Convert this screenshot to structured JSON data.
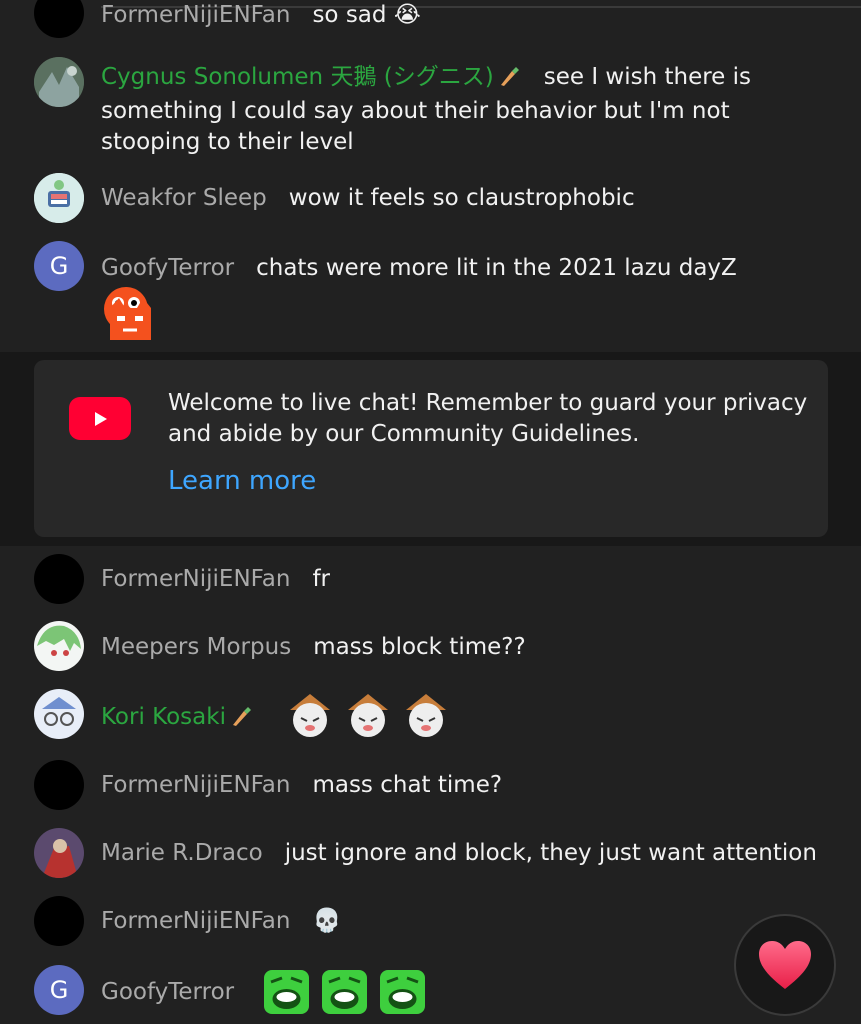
{
  "messages": [
    {
      "author": "FormerNijiENFan",
      "text": "so sad",
      "emoji": "😭"
    },
    {
      "author": "Cygnus Sonolumen 天鵝 (シグニス)",
      "text": "see I wish there is something I could say about their behavior but I'm not stooping to their level"
    },
    {
      "author": "Weakfor Sleep",
      "text": "wow it feels so claustrophobic"
    },
    {
      "author": "GoofyTerror",
      "text": "chats were more lit in the 2021 lazu dayZ",
      "avatar_letter": "G"
    },
    {
      "author": "FormerNijiENFan",
      "text": "fr"
    },
    {
      "author": "Meepers Morpus",
      "text": "mass block time??"
    },
    {
      "author": "Kori Kosaki",
      "text": ""
    },
    {
      "author": "FormerNijiENFan",
      "text": "mass chat time?"
    },
    {
      "author": "Marie R.Draco",
      "text": "just ignore and block, they just want attention"
    },
    {
      "author": "FormerNijiENFan",
      "text": "",
      "emoji": "💀"
    },
    {
      "author": "GoofyTerror",
      "text": "",
      "avatar_letter": "G"
    }
  ],
  "welcome": {
    "text": "Welcome to live chat! Remember to guard your privacy and abide by our Community Guidelines.",
    "link": "Learn more"
  },
  "colors": {
    "background": "#212121",
    "member_name": "#2ba640",
    "author_name": "#aaaaaa",
    "link": "#3ea6ff",
    "youtube_red": "#ff0033"
  },
  "icons": [
    "youtube-logo-icon",
    "member-badge-icon",
    "heart-icon",
    "skull-emoji",
    "crying-emoji"
  ]
}
